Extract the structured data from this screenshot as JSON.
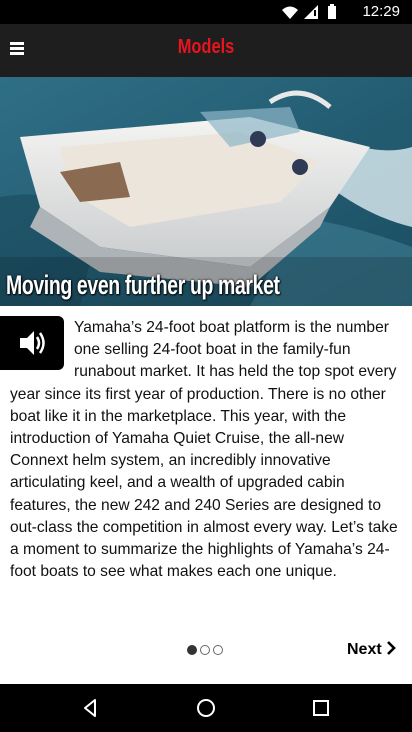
{
  "status": {
    "time": "12:29"
  },
  "appbar": {
    "title": "Models"
  },
  "hero": {
    "caption": "Moving even further up market"
  },
  "article": {
    "text": "Yamaha’s 24-foot boat platform is the number one selling 24-foot boat in the family-fun runabout market. It has held the top spot every year since its first year of production. There is no other boat like it in the marketplace. This year, with the introduction of Yamaha Quiet Cruise, the all-new Connext helm system, an incredibly innovative articulating keel, and a wealth of upgraded cabin features, the new 242 and 240 Series are designed to out-class the competition in almost every way. Let’s take a moment to summarize the highlights of Yamaha’s 24-foot boats to see what makes each one unique."
  },
  "pager": {
    "total": 3,
    "current": 1,
    "next_label": "Next"
  },
  "colors": {
    "title_red": "#e8141e",
    "appbar_bg": "#1e1e1e"
  },
  "icons": {
    "menu": "hamburger-icon",
    "audio": "speaker-icon",
    "next": "chevron-right-icon",
    "nav": [
      "back-icon",
      "home-icon",
      "recents-icon"
    ],
    "status": [
      "wifi-icon",
      "signal-icon",
      "battery-icon"
    ]
  }
}
